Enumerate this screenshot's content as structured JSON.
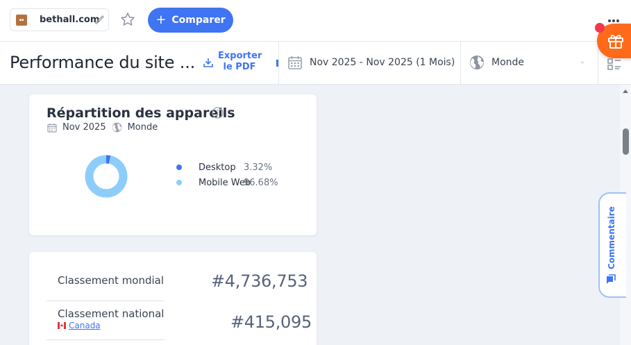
{
  "topbar": {
    "site_name": "bethall.com",
    "compare_label": "Comparer"
  },
  "header": {
    "title": "Performance du site ...",
    "export_label": "Exporter le PDF",
    "date_range": "Nov 2025 - Nov 2025 (1 Mois)",
    "region": "Monde"
  },
  "devices_card": {
    "title": "Répartition des appareils",
    "period": "Nov 2025",
    "region": "Monde",
    "chart_data": {
      "type": "pie",
      "categories": [
        "Desktop",
        "Mobile Web"
      ],
      "values": [
        3.32,
        96.68
      ],
      "value_labels": [
        "3.32%",
        "96.68%"
      ],
      "colors": [
        "#3f74f2",
        "#8ccdfb"
      ]
    }
  },
  "rank_card": {
    "global_label": "Classement mondial",
    "global_value": "#4,736,753",
    "national_label": "Classement national",
    "national_country": "Canada",
    "national_value": "#415,095"
  },
  "side": {
    "comment_label": "Commentaire"
  }
}
